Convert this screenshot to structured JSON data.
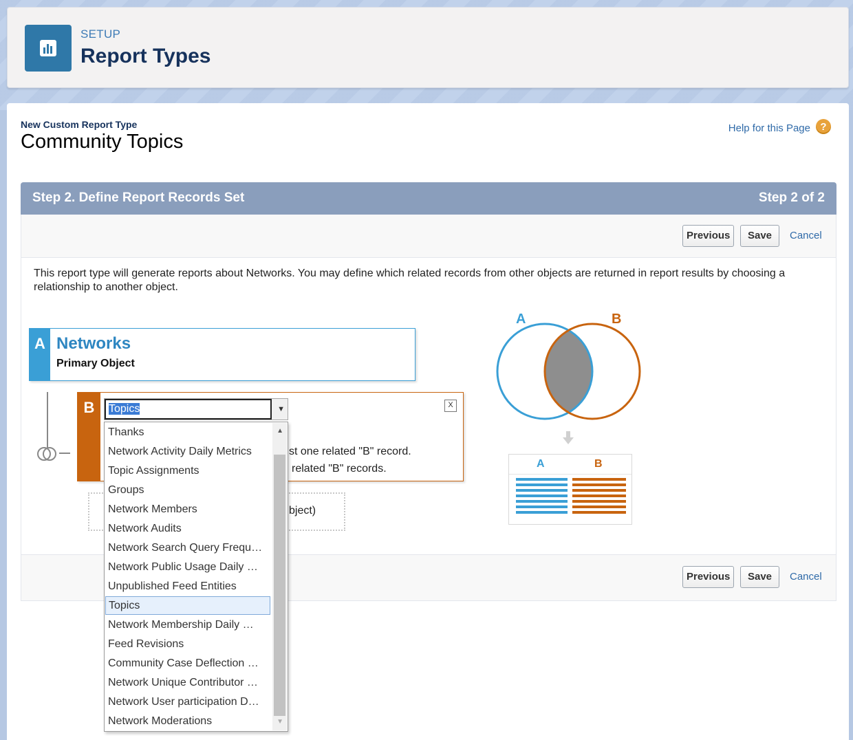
{
  "header": {
    "setup_label": "SETUP",
    "title": "Report Types",
    "icon": "report-chart-icon"
  },
  "page": {
    "crumb": "New Custom Report Type",
    "title": "Community Topics",
    "help_link": "Help for this Page",
    "help_icon": "?"
  },
  "step": {
    "title": "Step 2. Define Report Records Set",
    "counter": "Step 2 of 2"
  },
  "buttons": {
    "previous": "Previous",
    "save": "Save",
    "cancel": "Cancel"
  },
  "description": "This report type will generate reports about Networks. You may define which related records from other objects are returned in report results by choosing a relationship to another object.",
  "object_a": {
    "tag": "A",
    "name": "Networks",
    "subtitle": "Primary Object"
  },
  "object_b": {
    "tag": "B",
    "close": "X",
    "selected": "Topics",
    "option1_partial": "st one related \"B\" record.",
    "option2_partial": "related \"B\" records.",
    "add_partial": "bject)"
  },
  "dropdown": {
    "options": [
      "Thanks",
      "Network Activity Daily Metrics",
      "Topic Assignments",
      "Groups",
      "Network Members",
      "Network Audits",
      "Network Search Query Frequ…",
      "Network Public Usage Daily …",
      "Unpublished Feed Entities",
      "Topics",
      "Network Membership Daily …",
      "Feed Revisions",
      "Community Case Deflection …",
      "Network Unique Contributor …",
      "Network User participation D…",
      "Network Moderations"
    ],
    "highlighted": "Topics"
  },
  "diagram": {
    "label_a": "A",
    "label_b": "B",
    "color_a": "#3a9fd6",
    "color_b": "#c8640f"
  }
}
